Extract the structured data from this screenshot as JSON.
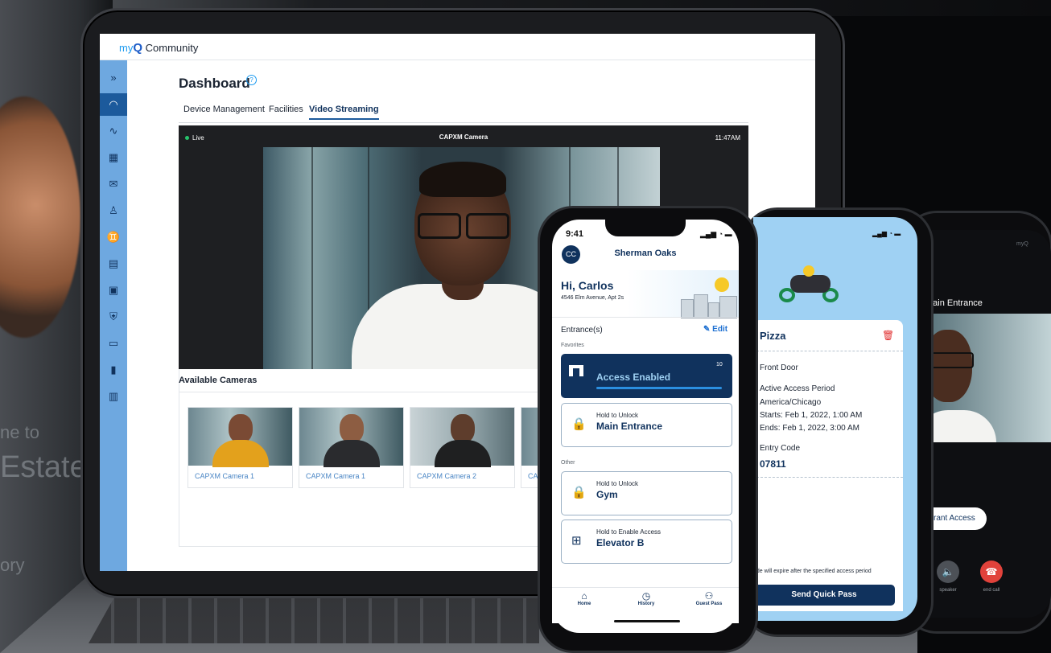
{
  "background": {
    "text_lines": [
      "ne to",
      "Estate",
      "ory"
    ]
  },
  "tablet": {
    "app_logo": {
      "my": "my",
      "q": "Q",
      "name": "Community"
    },
    "sidebar_icons": [
      "expand-icon",
      "dashboard-icon",
      "activity-icon",
      "building-icon",
      "mail-icon",
      "user-icon",
      "users-icon",
      "calendar-icon",
      "id-card-icon",
      "shield-icon",
      "money-icon",
      "chart-icon",
      "property-icon"
    ],
    "sidebar_glyphs": [
      "»",
      "◠",
      "∿",
      "▦",
      "✉",
      "♙",
      "♊",
      "▤",
      "▣",
      "⛨",
      "▭",
      "▮",
      "▥"
    ],
    "page_title": "Dashboard",
    "help_glyph": "?",
    "tabs": [
      "Device Management",
      "Facilities",
      "Video Streaming"
    ],
    "active_tab": "Video Streaming",
    "camera": {
      "status": "Live",
      "title": "CAPXM Camera",
      "time": "11:47AM"
    },
    "available_cameras_title": "Available Cameras",
    "cameras": [
      "CAPXM Camera 1",
      "CAPXM Camera 1",
      "CAPXM Camera 2",
      "CA"
    ]
  },
  "phone_front": {
    "time": "9:41",
    "status_icons": "▂▄▆ ◔ ▬",
    "avatar": "CC",
    "location": "Sherman Oaks",
    "greeting": "Hi, Carlos",
    "address": "4546 Elm Avenue, Apt 2s",
    "entrances_label": "Entrance(s)",
    "edit_label": "Edit",
    "edit_icon": "✎",
    "favorites_label": "Favorites",
    "access_card": {
      "title": "Access Enabled",
      "count": "10",
      "progress": 0.98
    },
    "favorites": [
      {
        "sub": "Hold to Unlock",
        "title": "Main Entrance",
        "icon": "lock-icon",
        "glyph": "🔒"
      }
    ],
    "other_label": "Other",
    "other": [
      {
        "sub": "Hold to Unlock",
        "title": "Gym",
        "icon": "lock-icon",
        "glyph": "🔒"
      },
      {
        "sub": "Hold to Enable Access",
        "title": "Elevator B",
        "icon": "elevator-icon",
        "glyph": "⊞"
      }
    ],
    "tab_bar": [
      {
        "label": "Home",
        "icon": "home-icon",
        "glyph": "⌂"
      },
      {
        "label": "History",
        "icon": "clock-icon",
        "glyph": "◷"
      },
      {
        "label": "Guest Pass",
        "icon": "guests-icon",
        "glyph": "⚇"
      }
    ]
  },
  "phone_middle": {
    "status_icons": "▂▄▆ ◔ ▬",
    "pass_title": "Pizza",
    "trash_glyph": "🗑",
    "door": "Front Door",
    "period_label": "Active Access Period",
    "timezone": "America/Chicago",
    "starts": "Starts: Feb 1, 2022, 1:00 AM",
    "ends": "Ends: Feb 1, 2022, 3:00 AM",
    "code_label": "Entry Code",
    "code": "07811",
    "note": "ode will expire after the specified access period",
    "send_button": "Send Quick Pass"
  },
  "phone_back": {
    "logo": "myQ",
    "entrance": "Main Entrance",
    "grant_button": "Grant Access",
    "speaker_label": "speaker",
    "speaker_glyph": "🔈",
    "end_label": "end call",
    "end_glyph": "☎"
  },
  "colors": {
    "navy": "#10325d",
    "sidebar": "#6ea8e0",
    "accent": "#1d9bf0",
    "danger": "#e02b2b"
  }
}
